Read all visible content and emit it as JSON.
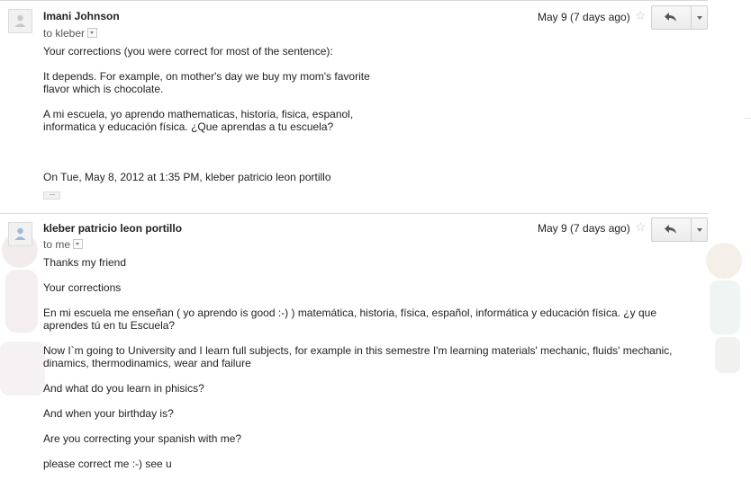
{
  "thread": {
    "messages": [
      {
        "sender": "Imani Johnson",
        "recipient": "to kleber",
        "date": "May 9 (7 days ago)",
        "star_icon": "star-icon",
        "reply_icon": "reply-icon",
        "more_icon": "chevron-down-icon",
        "body": [
          "Your corrections (you were correct for most of the sentence):",
          "It depends. For example, on mother's day we buy my mom's favorite",
          "flavor which is chocolate.",
          "A mi escuela, yo aprendo mathematicas, historia, fisica, espanol,",
          "informatica y educación física. ¿Que aprendas a tu escuela?",
          "On Tue, May 8, 2012 at 1:35 PM, kleber patricio leon portillo"
        ],
        "show_trimmed": "···"
      },
      {
        "sender": "kleber patricio leon portillo",
        "recipient": "to me",
        "date": "May 9 (7 days ago)",
        "star_icon": "star-icon",
        "reply_icon": "reply-icon",
        "more_icon": "chevron-down-icon",
        "body": [
          "Thanks my friend",
          " Your corrections",
          "En mi escuela me enseñan ( yo aprendo is good :-) ) matemática, historia, física, español, informática y educación física. ¿y que",
          "aprendes tú en tu Escuela?",
          "Now I`m going to University and I learn full subjects, for example in this semestre I'm learning materials' mechanic, fluids' mechanic,",
          "dinamics, thermodinamics, wear and failure",
          "And what do you learn in phisics?",
          "And when your birthday is?",
          "Are you correcting your spanish with me?",
          "please correct me :-) see u"
        ]
      }
    ]
  }
}
